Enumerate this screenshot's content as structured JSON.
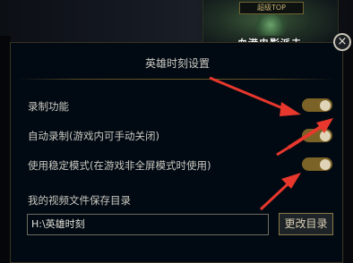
{
  "banner": {
    "top_label": "超级TOP",
    "text": "血港电影派去"
  },
  "dialog": {
    "title": "英雄时刻设置",
    "close_glyph": "×",
    "settings": [
      {
        "label": "录制功能",
        "enabled": true
      },
      {
        "label": "自动录制(游戏内可手动关闭)",
        "enabled": true
      },
      {
        "label": "使用稳定模式(在游戏非全屏模式时使用)",
        "enabled": true
      }
    ],
    "save_dir_label": "我的视频文件保存目录",
    "save_dir_value": "H:\\英雄时刻",
    "change_dir_button": "更改目录"
  },
  "colors": {
    "toggle_on": "#7b6226",
    "arrow": "#e8372c",
    "accent_border": "#8a7a45"
  }
}
